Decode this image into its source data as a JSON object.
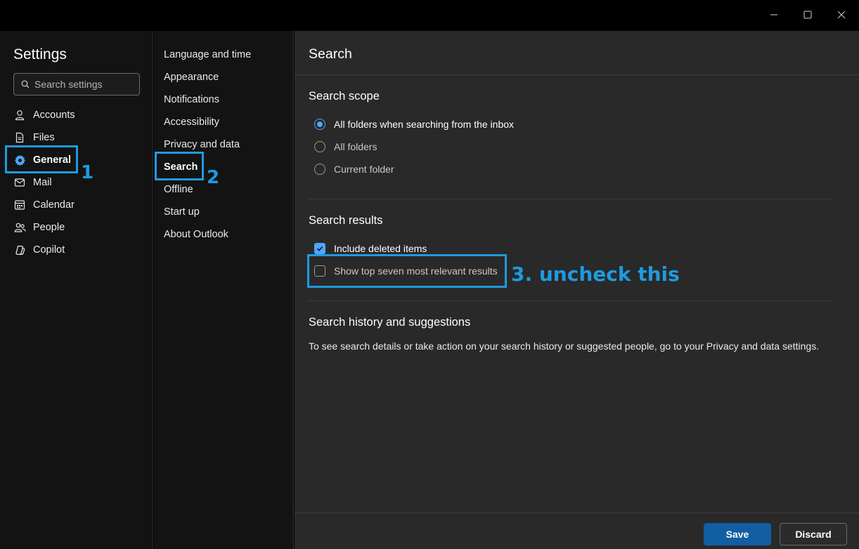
{
  "window": {
    "controls": [
      "minimize-icon",
      "maximize-icon",
      "close-icon"
    ]
  },
  "sidebar": {
    "title": "Settings",
    "search_placeholder": "Search settings",
    "items": [
      {
        "label": "Accounts",
        "icon": "person-icon"
      },
      {
        "label": "Files",
        "icon": "file-icon"
      },
      {
        "label": "General",
        "icon": "gear-icon",
        "active": true
      },
      {
        "label": "Mail",
        "icon": "mail-icon"
      },
      {
        "label": "Calendar",
        "icon": "calendar-icon"
      },
      {
        "label": "People",
        "icon": "people-icon"
      },
      {
        "label": "Copilot",
        "icon": "copilot-icon"
      }
    ]
  },
  "subnav": {
    "items": [
      {
        "label": "Language and time"
      },
      {
        "label": "Appearance"
      },
      {
        "label": "Notifications"
      },
      {
        "label": "Accessibility"
      },
      {
        "label": "Privacy and data"
      },
      {
        "label": "Search",
        "active": true
      },
      {
        "label": "Offline"
      },
      {
        "label": "Start up"
      },
      {
        "label": "About Outlook"
      }
    ]
  },
  "main": {
    "title": "Search",
    "scope": {
      "title": "Search scope",
      "options": [
        {
          "label": "All folders when searching from the inbox",
          "checked": true
        },
        {
          "label": "All folders",
          "checked": false
        },
        {
          "label": "Current folder",
          "checked": false
        }
      ]
    },
    "results": {
      "title": "Search results",
      "options": [
        {
          "label": "Include deleted items",
          "checked": true
        },
        {
          "label": "Show top seven most relevant results",
          "checked": false
        }
      ]
    },
    "history": {
      "title": "Search history and suggestions",
      "text": "To see search details or take action on your search history or suggested people, go to your Privacy and data settings."
    },
    "footer": {
      "save_label": "Save",
      "discard_label": "Discard"
    }
  },
  "annotations": {
    "step1": "1",
    "step2": "2",
    "step3": "3. uncheck this",
    "color": "#1f9ae0"
  },
  "colors": {
    "accent": "#4ea6ff",
    "primary_button": "#115ea3",
    "background": "#292929"
  }
}
